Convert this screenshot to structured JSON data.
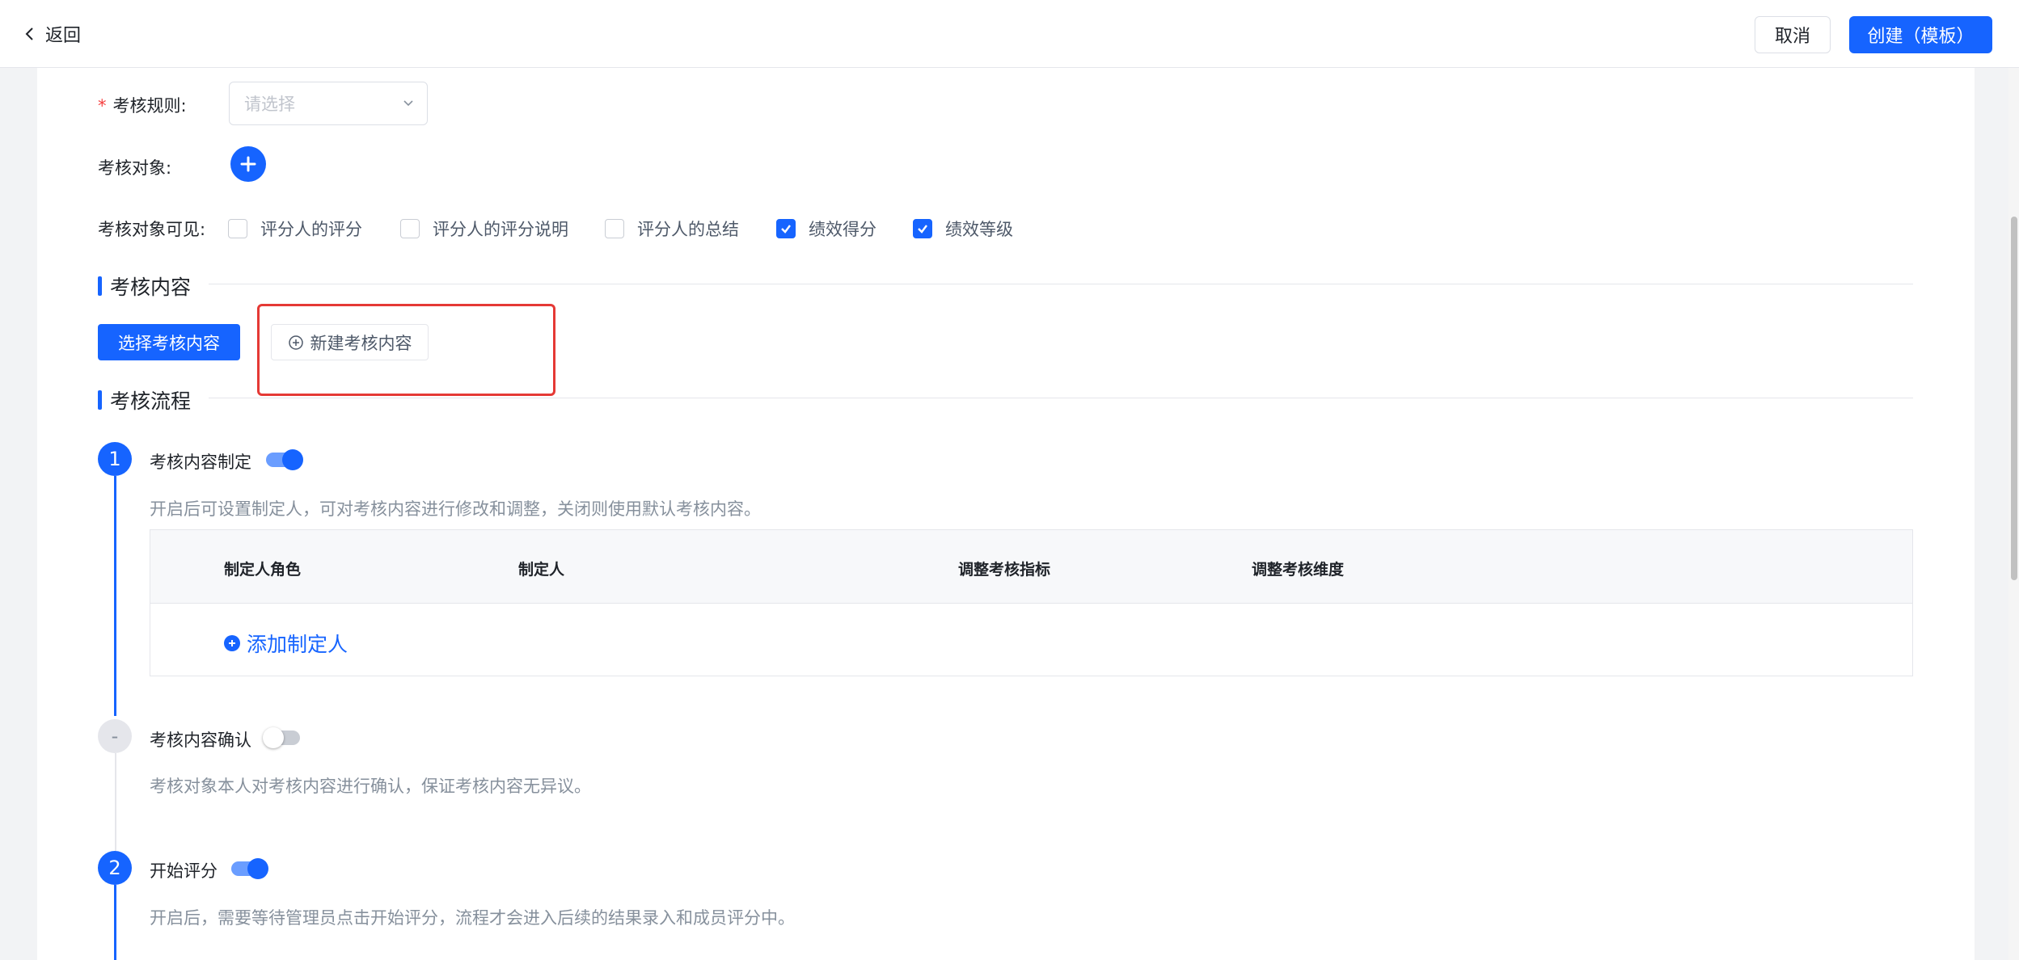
{
  "header": {
    "back_label": "返回",
    "cancel_label": "取消",
    "create_label": "创建（模板）"
  },
  "form": {
    "rule": {
      "required_mark": "*",
      "label": "考核规则:",
      "placeholder": "请选择"
    },
    "target": {
      "label": "考核对象:"
    },
    "visible": {
      "label": "考核对象可见:",
      "options": [
        {
          "label": "评分人的评分",
          "checked": false
        },
        {
          "label": "评分人的评分说明",
          "checked": false
        },
        {
          "label": "评分人的总结",
          "checked": false
        },
        {
          "label": "绩效得分",
          "checked": true
        },
        {
          "label": "绩效等级",
          "checked": true
        }
      ]
    }
  },
  "content_section": {
    "title": "考核内容",
    "select_button": "选择考核内容",
    "new_button": "新建考核内容"
  },
  "flow_section": {
    "title": "考核流程",
    "steps": [
      {
        "marker": "1",
        "title": "考核内容制定",
        "enabled": true,
        "desc": "开启后可设置制定人，可对考核内容进行修改和调整，关闭则使用默认考核内容。"
      },
      {
        "marker": "-",
        "title": "考核内容确认",
        "enabled": false,
        "desc": "考核对象本人对考核内容进行确认，保证考核内容无异议。"
      },
      {
        "marker": "2",
        "title": "开始评分",
        "enabled": true,
        "desc": "开启后，需要等待管理员点击开始评分，流程才会进入后续的结果录入和成员评分中。"
      }
    ],
    "maker_table": {
      "columns": [
        "制定人角色",
        "制定人",
        "调整考核指标",
        "调整考核维度"
      ],
      "add_label": "添加制定人"
    }
  },
  "colors": {
    "primary": "#1664ff",
    "highlight_box": "#e53935"
  }
}
